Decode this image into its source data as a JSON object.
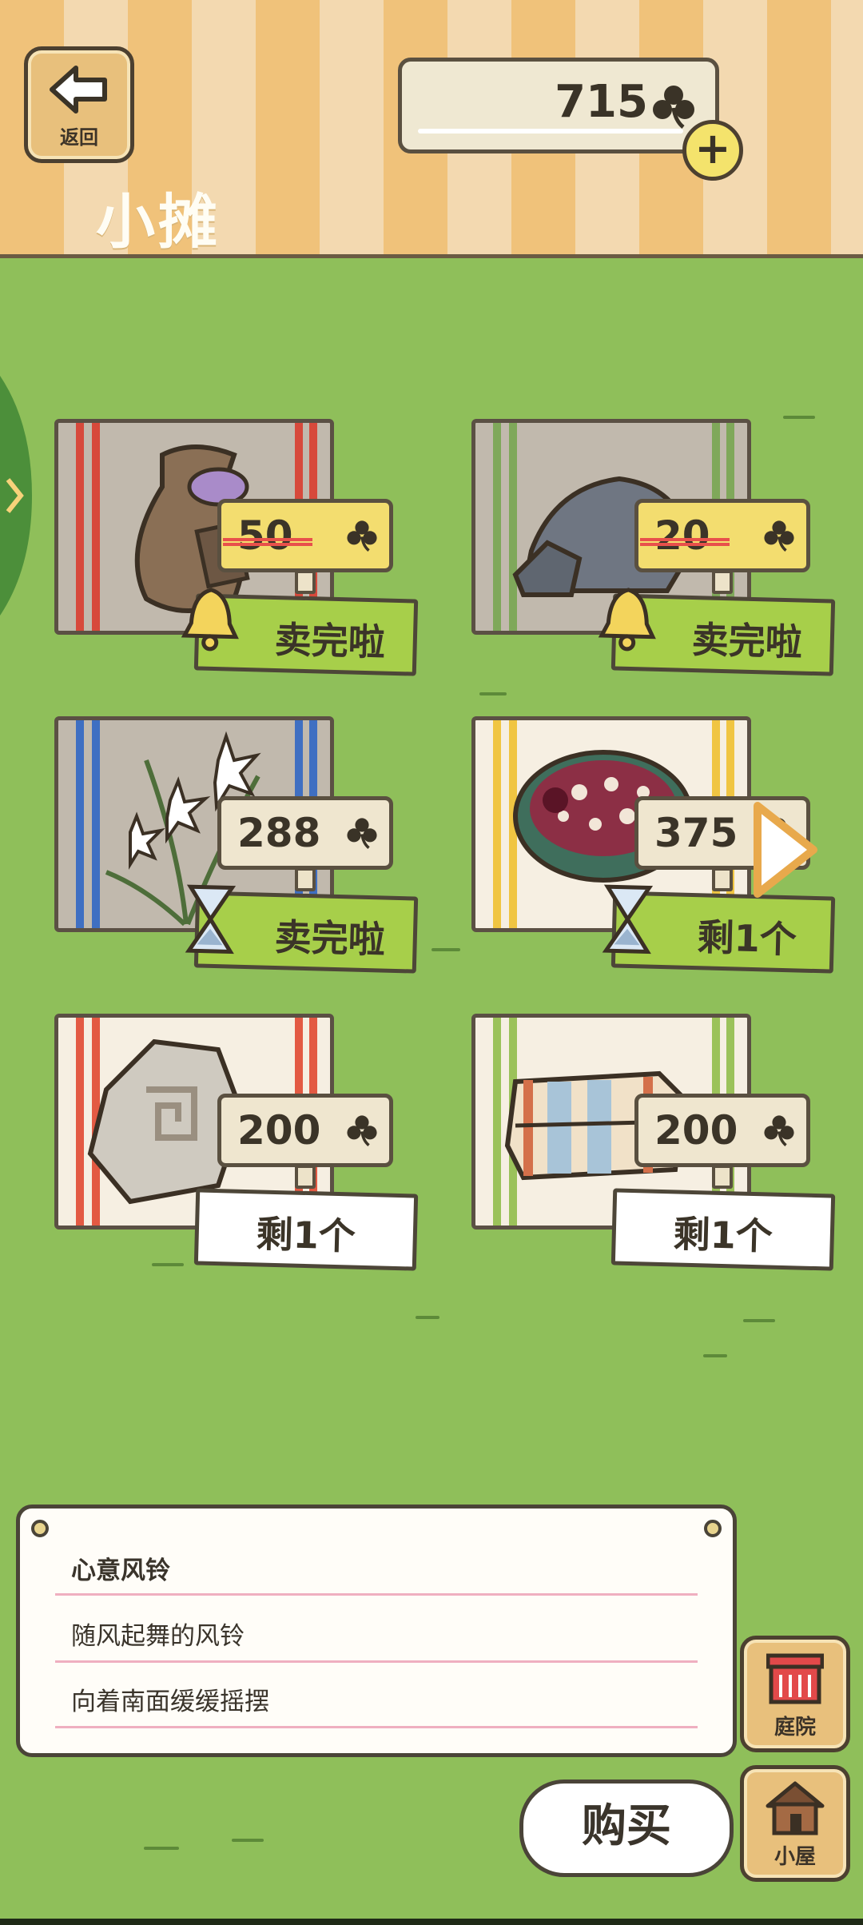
{
  "header": {
    "back_label": "返回",
    "title": "小摊",
    "coins": "715",
    "add_label": "+"
  },
  "items": [
    {
      "name": "心意风铃",
      "price": "50",
      "price_struck": true,
      "status": "卖完啦",
      "status_icon": "bell-icon",
      "art": "pouch"
    },
    {
      "name": "",
      "price": "20",
      "price_struck": true,
      "status": "卖完啦",
      "status_icon": "bell-icon",
      "art": "rock"
    },
    {
      "name": "",
      "price": "288",
      "price_struck": false,
      "status": "卖完啦",
      "status_icon": "hourglass-icon",
      "art": "orchid"
    },
    {
      "name": "",
      "price": "375",
      "price_struck": false,
      "status": "剩1个",
      "status_icon": "hourglass-icon",
      "art": "porridge-bowl"
    },
    {
      "name": "",
      "price": "200",
      "price_struck": false,
      "status": "剩1个",
      "status_icon": "",
      "art": "stone-tablet"
    },
    {
      "name": "",
      "price": "200",
      "price_struck": false,
      "status": "剩1个",
      "status_icon": "",
      "art": "folded-cloth"
    }
  ],
  "info": {
    "item_name": "心意风铃",
    "line1": "随风起舞的风铃",
    "line2": "向着南面缓缓摇摆"
  },
  "buy_label": "购买",
  "nav": {
    "yard_label": "庭院",
    "house_label": "小屋"
  },
  "colors": {
    "grass": "#8fbf5a",
    "sold_green": "#a7cf4a",
    "gold_tag": "#f3dd6f"
  }
}
